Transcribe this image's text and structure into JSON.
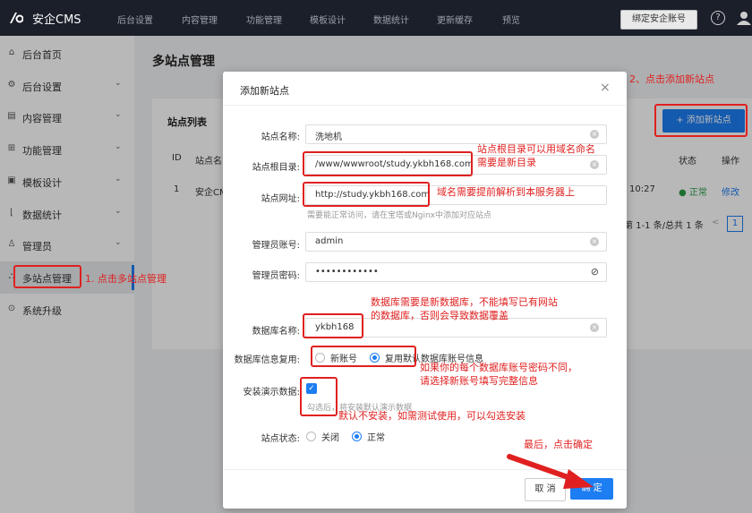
{
  "topbar": {
    "logo_text": "安企CMS",
    "nav": [
      "后台设置",
      "内容管理",
      "功能管理",
      "模板设计",
      "数据统计",
      "更新缓存",
      "预览"
    ],
    "bind_account_label": "绑定安企账号",
    "help_icon": "?"
  },
  "sidebar": {
    "items": [
      {
        "icon": "⌂",
        "label": "后台首页",
        "arrow": ""
      },
      {
        "icon": "⚙",
        "label": "后台设置",
        "arrow": "⌄"
      },
      {
        "icon": "▤",
        "label": "内容管理",
        "arrow": "⌄"
      },
      {
        "icon": "⊞",
        "label": "功能管理",
        "arrow": "⌄"
      },
      {
        "icon": "▣",
        "label": "模板设计",
        "arrow": "⌄"
      },
      {
        "icon": "⌊",
        "label": "数据统计",
        "arrow": "⌄"
      },
      {
        "icon": "♙",
        "label": "管理员",
        "arrow": "⌄"
      },
      {
        "icon": "⛬",
        "label": "多站点管理",
        "arrow": ""
      },
      {
        "icon": "⊙",
        "label": "系统升级",
        "arrow": ""
      }
    ]
  },
  "main": {
    "page_title": "多站点管理",
    "list_title": "站点列表",
    "add_site_label": "+ 添加新站点",
    "columns": {
      "id": "ID",
      "name": "站点名",
      "status": "状态",
      "action": "操作"
    },
    "row": {
      "id": "1",
      "name": "安企CM",
      "time": "10:27",
      "status": "正常",
      "action": "修改"
    },
    "pager_text": "第 1-1 条/总共 1 条",
    "pager_prev": "<",
    "pager_page": "1"
  },
  "modal": {
    "title": "添加新站点",
    "close": "×",
    "fields": {
      "site_name": {
        "label": "站点名称:",
        "value": "洗地机"
      },
      "root_dir": {
        "label": "站点根目录:",
        "value": "/www/wwwroot/study.ykbh168.com"
      },
      "site_url": {
        "label": "站点网址:",
        "value": "http://study.ykbh168.com",
        "hint": "需要能正常访问，请在宝塔或Nginx中添加对应站点"
      },
      "admin_user": {
        "label": "管理员账号:",
        "value": "admin"
      },
      "admin_password": {
        "label": "管理员密码:",
        "value": "••••••••••••"
      },
      "db_name": {
        "label": "数据库名称:",
        "value": "ykbh168"
      },
      "db_reuse": {
        "label": "数据库信息复用:",
        "options": [
          "新账号",
          "复用默认数据库账号信息"
        ],
        "selected": 1
      },
      "demo_data": {
        "label": "安装演示数据:",
        "hint": "勾选后，将安装默认演示数据"
      },
      "site_status": {
        "label": "站点状态:",
        "options": [
          "关闭",
          "正常"
        ],
        "selected": 1
      }
    },
    "cancel_label": "取 消",
    "confirm_label": "确 定"
  },
  "annotations": {
    "step1": "1. 点击多站点管理",
    "step2": "2、点击添加新站点",
    "root_dir_note": [
      "站点根目录可以用域名命名",
      "需要是新目录"
    ],
    "url_note": "域名需要提前解析到本服务器上",
    "db_note": [
      "数据库需要是新数据库，不能填写已有网站",
      "的数据库，否则会导致数据覆盖"
    ],
    "reuse_note": [
      "如果你的每个数据库账号密码不同，",
      "请选择新账号填写完整信息"
    ],
    "demo_note": "默认不安装，如需测试使用，可以勾选安装",
    "final_note": "最后，点击确定"
  },
  "colors": {
    "accent": "#1d7df2",
    "annotation": "#e02020",
    "topbar": "#1b1f2a"
  }
}
